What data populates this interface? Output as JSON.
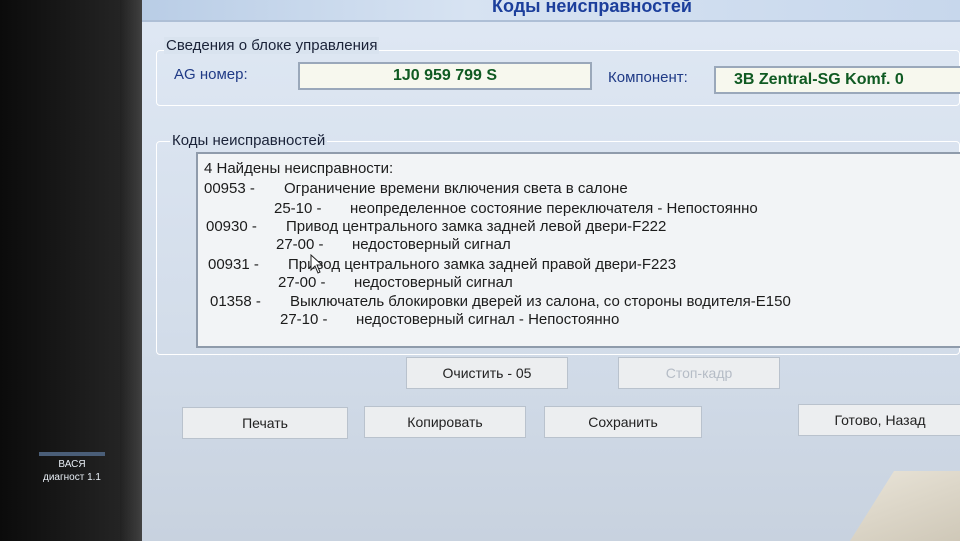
{
  "window": {
    "title": "Коды неисправностей"
  },
  "control_unit": {
    "group_label": "Сведения о блоке управления",
    "vag_label": "AG номер:",
    "vag_value": "1J0 959 799 S",
    "component_label": "Компонент:",
    "component_value": "3B Zentral-SG Komf. 0"
  },
  "fault_codes": {
    "group_label": "Коды неисправностей",
    "header": "4 Найдены неисправности:",
    "entries": [
      {
        "code": "00953 -",
        "description": "Ограничение времени включения света в салоне",
        "sub_code": "25-10 -",
        "sub_description": "неопределенное состояние переключателя - Непостоянно"
      },
      {
        "code": "00930 -",
        "description": "Привод центрального замка задней левой двери-F222",
        "sub_code": "27-00 -",
        "sub_description": "недостоверный сигнал"
      },
      {
        "code": "00931 -",
        "description": "Привод центрального замка задней правой двери-F223",
        "sub_code": "27-00 -",
        "sub_description": "недостоверный сигнал"
      },
      {
        "code": "01358 -",
        "description": "Выключатель блокировки дверей из салона, со стороны водителя-E150",
        "sub_code": "27-10 -",
        "sub_description": "недостоверный сигнал - Непостоянно"
      }
    ]
  },
  "buttons": {
    "clear": "Очистить - 05",
    "freeze_frame": "Стоп-кадр",
    "print": "Печать",
    "copy": "Копировать",
    "save": "Сохранить",
    "done_back": "Готово, Назад"
  },
  "desktop_icon": {
    "line1": "ВАСЯ",
    "line2": "диагност 1.1"
  }
}
